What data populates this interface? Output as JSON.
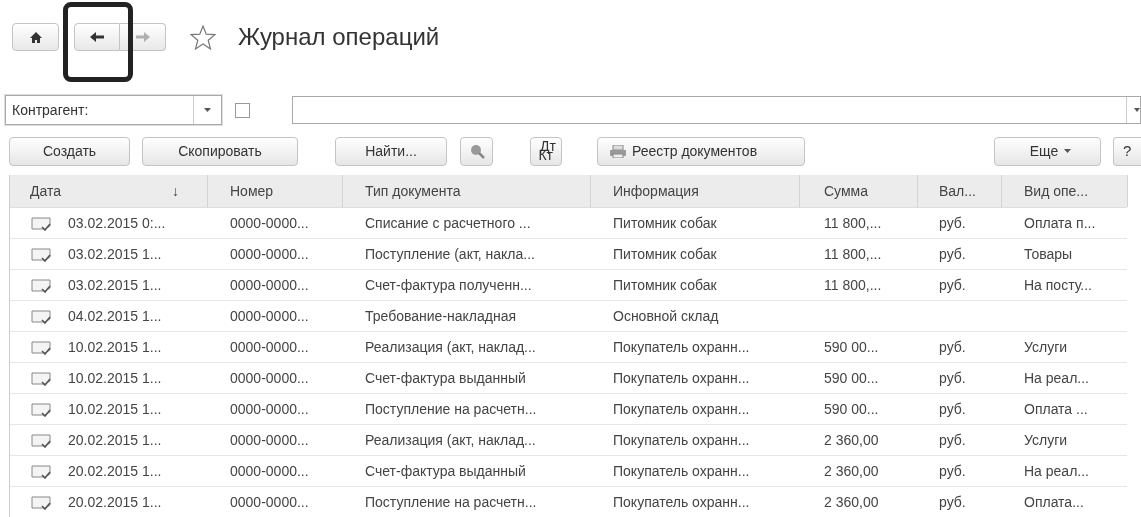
{
  "nav": {
    "buttons": [
      {
        "kind": "home",
        "disabled": false
      },
      {
        "kind": "back",
        "disabled": false
      },
      {
        "kind": "forward",
        "disabled": true
      }
    ],
    "favorite": false,
    "title": "Журнал операций"
  },
  "filter": {
    "label": "Контрагент:",
    "checked": false
  },
  "toolbar": [
    {
      "kind": "text",
      "label": "Создать"
    },
    {
      "kind": "text",
      "label": "Скопировать"
    },
    {
      "kind": "text",
      "label": "Найти..."
    },
    {
      "kind": "search-clear"
    },
    {
      "kind": "dtkt",
      "label": "Дт",
      "sublabel": "Кт"
    },
    {
      "kind": "print",
      "label": "Реестр документов"
    },
    {
      "kind": "menu",
      "label": "Еще"
    },
    {
      "kind": "help",
      "label": "?"
    }
  ],
  "table": {
    "columns": [
      {
        "label": "Дата",
        "sort": "↓"
      },
      {
        "label": "Номер"
      },
      {
        "label": "Тип документа"
      },
      {
        "label": "Информация"
      },
      {
        "label": "Сумма"
      },
      {
        "label": "Вал..."
      },
      {
        "label": "Вид опе..."
      }
    ],
    "rows": [
      [
        "03.02.2015 0:...",
        "0000-0000...",
        "Списание с расчетного ...",
        "Питомник собак",
        "11 800,...",
        "руб.",
        "Оплата п..."
      ],
      [
        "03.02.2015 1...",
        "0000-0000...",
        "Поступление (акт, накла...",
        "Питомник собак",
        "11 800,...",
        "руб.",
        "Товары"
      ],
      [
        "03.02.2015 1...",
        "0000-0000...",
        "Счет-фактура полученн...",
        "Питомник собак",
        "11 800,...",
        "руб.",
        "На посту..."
      ],
      [
        "04.02.2015 1...",
        "0000-0000...",
        "Требование-накладная",
        "Основной склад"
      ],
      [
        "10.02.2015 1...",
        "0000-0000...",
        "Реализация (акт, наклад...",
        "Покупатель охранн...",
        "590 00...",
        "руб.",
        "Услуги"
      ],
      [
        "10.02.2015 1...",
        "0000-0000...",
        "Счет-фактура выданный",
        "Покупатель охранн...",
        "590 00...",
        "руб.",
        "На реал..."
      ],
      [
        "10.02.2015 1...",
        "0000-0000...",
        "Поступление на расчетн...",
        "Покупатель охранн...",
        "590 00...",
        "руб.",
        "Оплата ..."
      ],
      [
        "20.02.2015 1...",
        "0000-0000...",
        "Реализация (акт, наклад...",
        "Покупатель охранн...",
        "2 360,00",
        "руб.",
        "Услуги"
      ],
      [
        "20.02.2015 1...",
        "0000-0000...",
        "Счет-фактура выданный",
        "Покупатель охранн...",
        "2 360,00",
        "руб.",
        "На реал..."
      ],
      [
        "20.02.2015 1...",
        "0000-0000...",
        "Поступление на расчетн...",
        "Покупатель охранн...",
        "2 360,00",
        "руб.",
        "Оплата..."
      ]
    ]
  }
}
